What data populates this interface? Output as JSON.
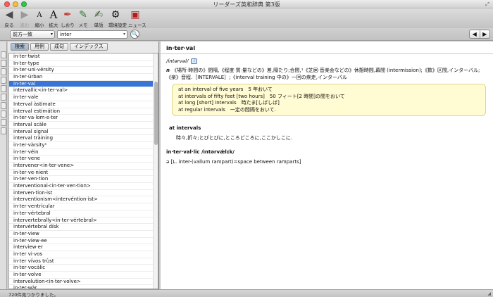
{
  "window": {
    "title": "リーダーズ英和辞典 第3版",
    "fullscreen_glyph": "⤢"
  },
  "toolbar": {
    "back": {
      "label": "戻る",
      "icon": "back-arrow-icon",
      "glyph": "◀"
    },
    "forward": {
      "label": "進む",
      "icon": "forward-arrow-icon",
      "glyph": "▶"
    },
    "shrink": {
      "label": "縮小",
      "icon": "shrink-font-icon",
      "glyph": "A"
    },
    "enlarge": {
      "label": "拡大",
      "icon": "enlarge-font-icon",
      "glyph": "A"
    },
    "bookmark": {
      "label": "しおり",
      "icon": "pen-icon",
      "glyph": "✒"
    },
    "memo": {
      "label": "メモ",
      "icon": "memo-icon",
      "glyph": "✎"
    },
    "wordbook": {
      "label": "単語",
      "icon": "wordbook-icon",
      "glyph": "✍"
    },
    "settings": {
      "label": "環境設定",
      "icon": "gear-icon",
      "glyph": "⚙"
    },
    "news": {
      "label": "ニュース",
      "icon": "news-icon",
      "glyph": "▣"
    }
  },
  "search": {
    "mode": "前方一致",
    "mode_arrow": "▾",
    "query": "inter",
    "query_arrow": "▾",
    "button_glyph": "🔍",
    "prev_glyph": "◀▶",
    "next_glyph": "▶"
  },
  "side_tabs": [
    "",
    "",
    "",
    "",
    "",
    "",
    "",
    "",
    "",
    ""
  ],
  "tabs": [
    "検索",
    "用例",
    "成句",
    "インデックス"
  ],
  "word_list": [
    "in·ter·twist",
    "In·ter·type",
    "In·ter·uni·vérsity",
    "In·ter·úrban",
    "in·ter·val",
    "intervallic<in·ter·val>",
    "in·ter·vale",
    "Interval àstimate",
    "interval estimátion",
    "in·ter·va·lom·e·ter",
    "interval scàle",
    "interval sígnal",
    "interval tràining",
    "in·ter·vàrsity¹",
    "in·ter·véin",
    "in·ter·vene",
    "intervener<in·ter·vene>",
    "in·ter·ve·nient",
    "in·ter·ven·tion",
    "interventional<in·ter·ven·tion>",
    "interven·tion·ist",
    "interventionism<intervéntion·ist>",
    "in·ter·ventrícular",
    "in·ter·vértebral",
    "intervertebrally<in·ter·vértebral>",
    "intervértebral dísk",
    "in·ter·view",
    "in·ter·view·ee",
    "interview·er",
    "in·ter vi·vos",
    "in·ter vívos trùst",
    "in·ter·vocálic",
    "in·ter·volve",
    "intervolution<in·ter·volve>",
    "in·ter·wàr"
  ],
  "selected_index": 4,
  "entry": {
    "headword": "in·ter·val",
    "pronunciation": "/íntərvəl/",
    "audio_glyph": "♪",
    "pos": "n",
    "definition": "《場所·時間の》間隔,《程度·質·量などの》差,隔たり;合間,¹《芝居·音楽会などの》休憩時間,幕間 (intermission);《数》区間,インターバル;《楽》音程.［INTERVALE］;《interval training 中の》一回の疾走,インターバル",
    "examples": [
      "at an interval of five years　5 年おいて",
      "at intervals of fifty feet [two hours]　50 フィート[2 時間]の間をおいて",
      "at long [short] intervals　時たま[しばしば]",
      "at regular intervals　一定の間隔をおいて."
    ],
    "subentry_title": "at intervals",
    "subentry_definition": "時々,折々;とびとびに,ところどころに,ここかしこに.",
    "second_headword": "in·ter·val·lic /ìntərvǽlɪk/",
    "etymology": "ə [L. inter-(vallum rampart)=space between ramparts]"
  },
  "status": {
    "text": "720件見つかりました。",
    "resize_glyph": "◢"
  }
}
